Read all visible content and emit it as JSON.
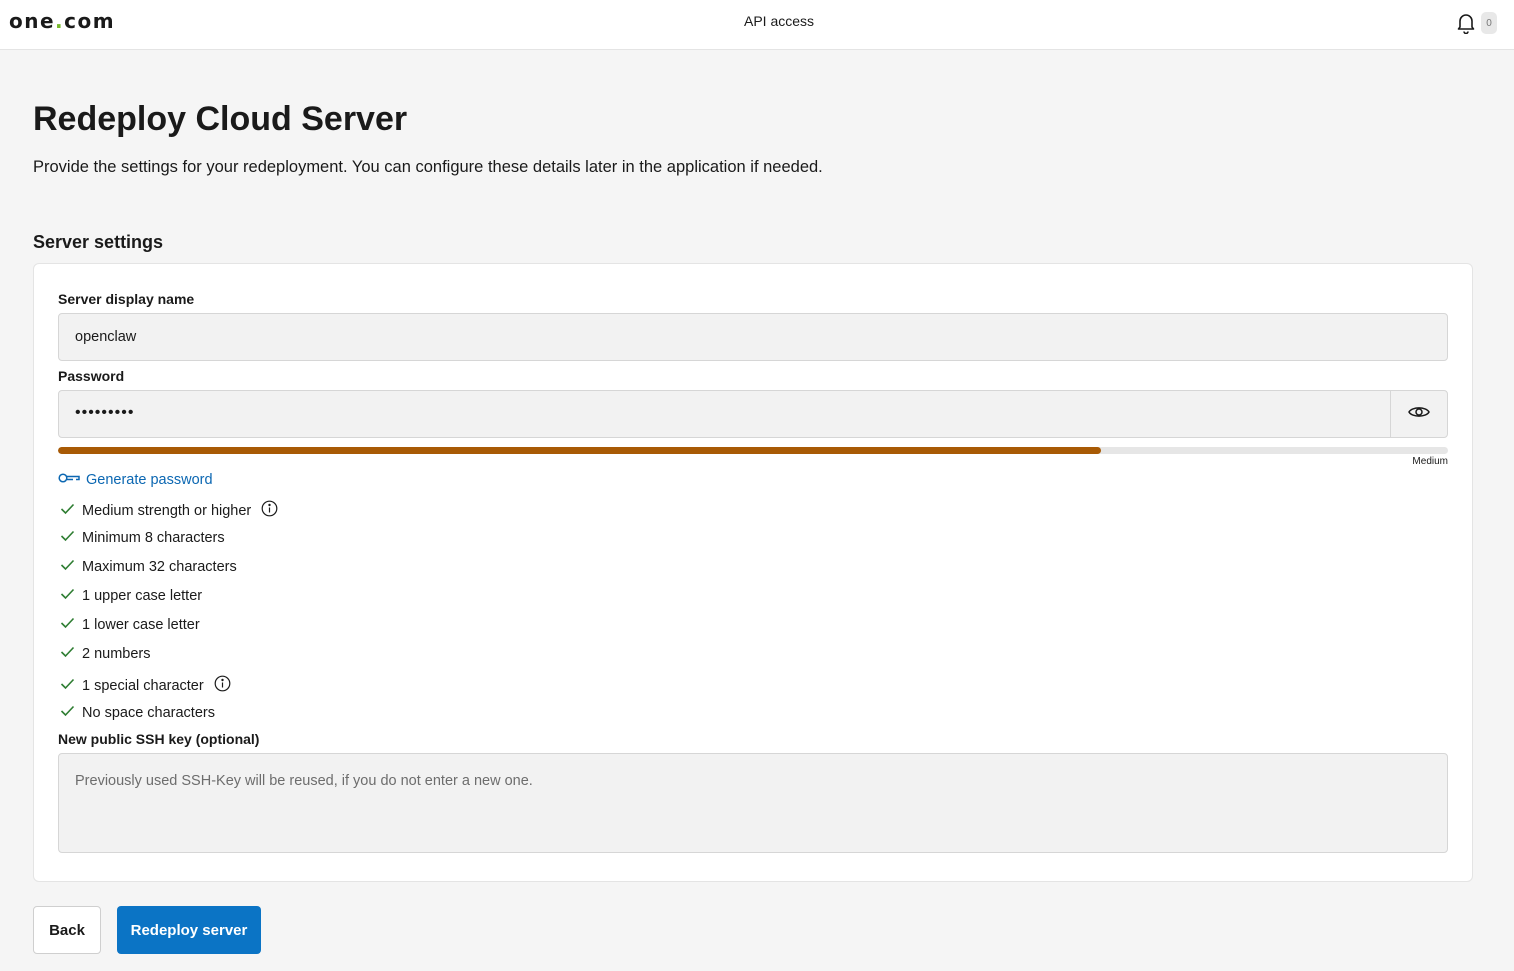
{
  "header": {
    "logo_text_a": "one",
    "logo_dot": ".",
    "logo_text_b": "com",
    "api_link": "API access",
    "notification_count": "0"
  },
  "page": {
    "title": "Redeploy Cloud Server",
    "description": "Provide the settings for your redeployment. You can configure these details later in the application if needed.",
    "section_title": "Server settings"
  },
  "form": {
    "display_name_label": "Server display name",
    "display_name_value": "openclaw",
    "password_label": "Password",
    "password_masked": "•••••••••",
    "strength_label": "Medium",
    "strength_fraction": 0.75,
    "generate_label": "Generate password",
    "rules": [
      {
        "label": "Medium strength or higher",
        "info": true
      },
      {
        "label": "Minimum 8 characters",
        "info": false
      },
      {
        "label": "Maximum 32 characters",
        "info": false
      },
      {
        "label": "1 upper case letter",
        "info": false
      },
      {
        "label": "1 lower case letter",
        "info": false
      },
      {
        "label": "2 numbers",
        "info": false
      },
      {
        "label": "1 special character",
        "info": true
      },
      {
        "label": "No space characters",
        "info": false
      }
    ],
    "ssh_label": "New public SSH key (optional)",
    "ssh_placeholder": "Previously used SSH-Key will be reused, if you do not enter a new one."
  },
  "actions": {
    "back_label": "Back",
    "redeploy_label": "Redeploy server"
  },
  "colors": {
    "accent_blue": "#0b74c5",
    "link_blue": "#0b67b2",
    "strength_medium": "#a85a05",
    "check_green": "#2e7d32",
    "logo_dot_green": "#76b82a"
  },
  "icons": {
    "bell": "bell-icon",
    "eye": "eye-icon",
    "key": "key-icon",
    "check": "check-icon",
    "info": "info-icon"
  }
}
